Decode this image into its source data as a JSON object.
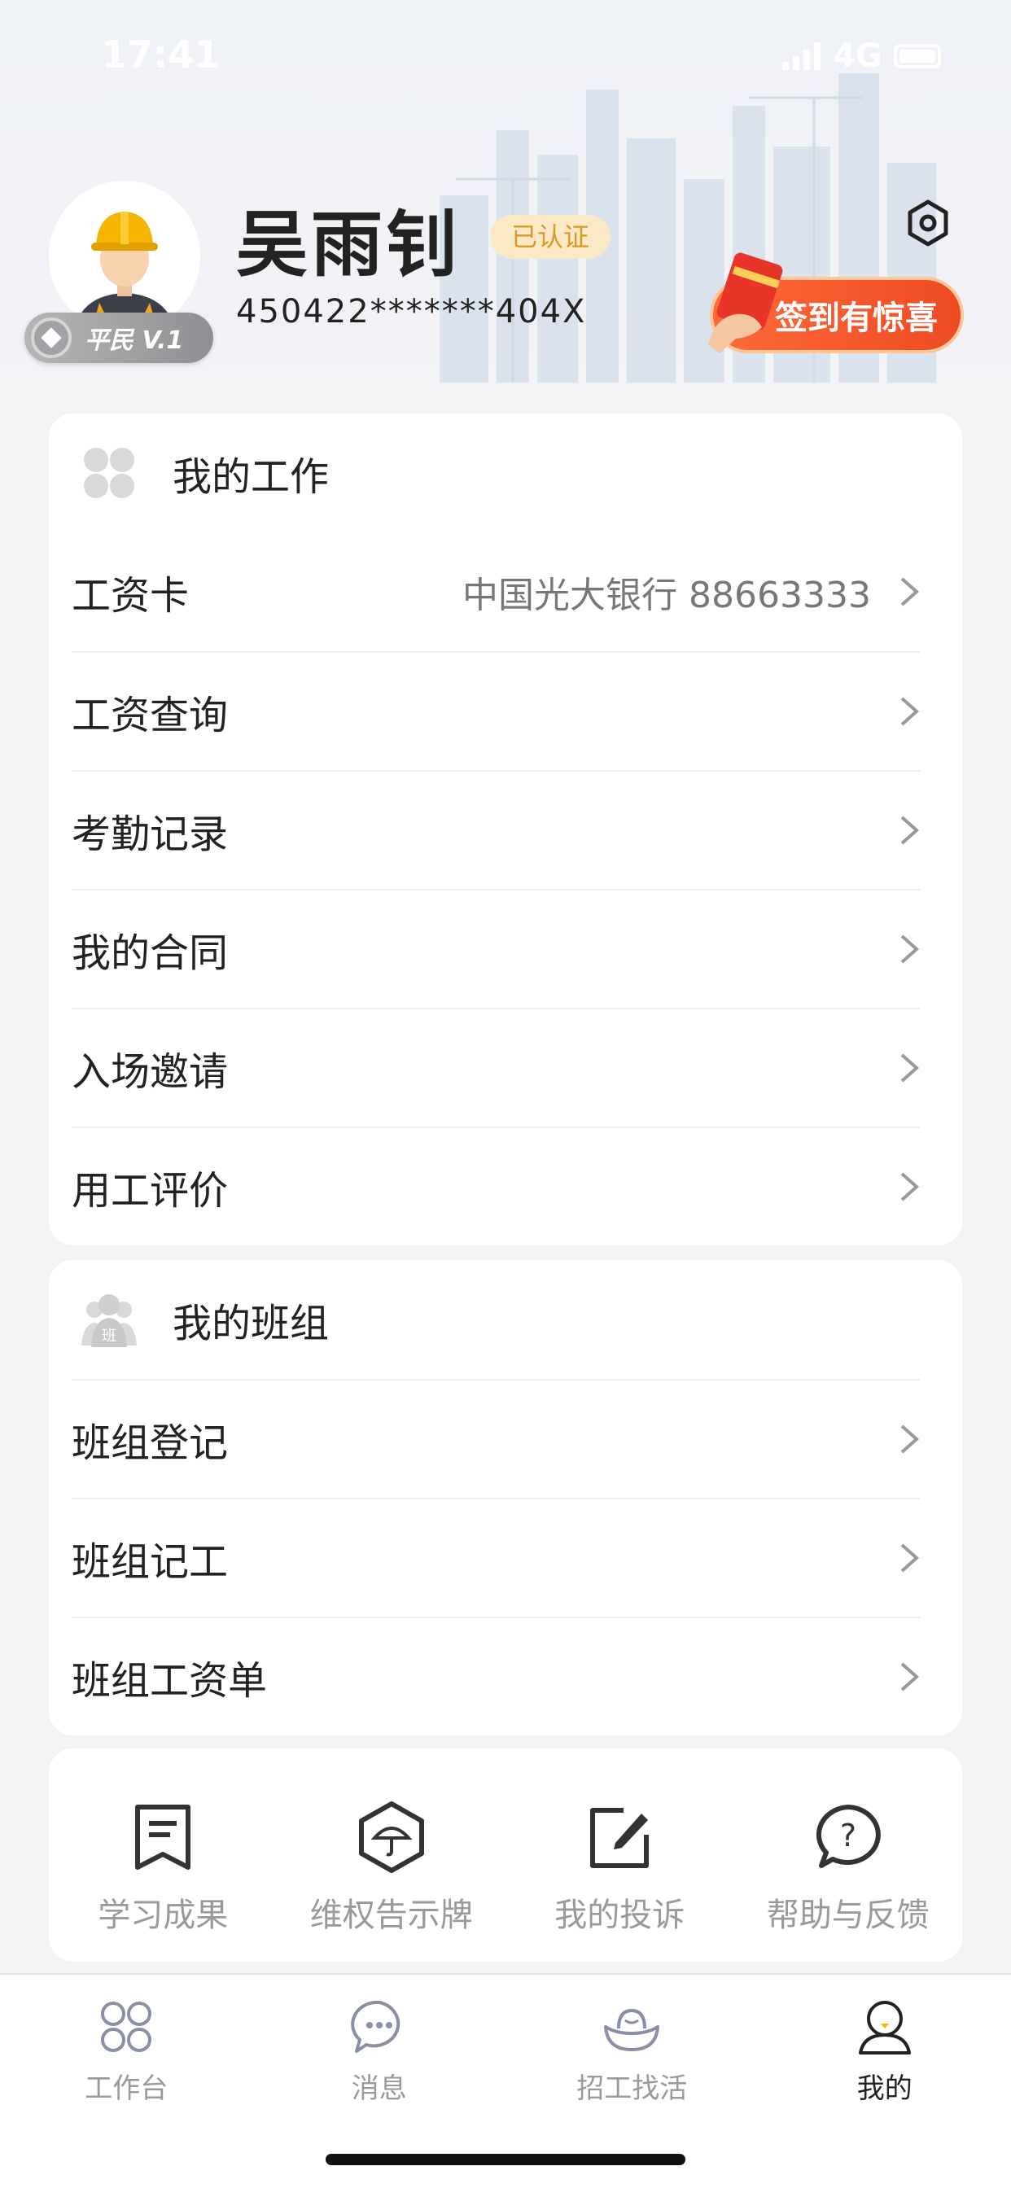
{
  "status_bar": {
    "time": "17:41",
    "network": "4G"
  },
  "profile": {
    "name": "吴雨钊",
    "verified_label": "已认证",
    "id_number": "450422*******404X",
    "level_badge": "平民 V.1",
    "checkin_label": "签到有惊喜"
  },
  "my_work": {
    "title": "我的工作",
    "items": [
      {
        "label": "工资卡",
        "value": "中国光大银行 88663333"
      },
      {
        "label": "工资查询",
        "value": ""
      },
      {
        "label": "考勤记录",
        "value": ""
      },
      {
        "label": "我的合同",
        "value": ""
      },
      {
        "label": "入场邀请",
        "value": ""
      },
      {
        "label": "用工评价",
        "value": ""
      }
    ]
  },
  "my_team": {
    "title": "我的班组",
    "items": [
      {
        "label": "班组登记"
      },
      {
        "label": "班组记工"
      },
      {
        "label": "班组工资单"
      }
    ]
  },
  "shortcuts": [
    {
      "label": "学习成果",
      "icon": "bookmark-icon"
    },
    {
      "label": "维权告示牌",
      "icon": "umbrella-hexagon-icon"
    },
    {
      "label": "我的投诉",
      "icon": "edit-icon"
    },
    {
      "label": "帮助与反馈",
      "icon": "question-bubble-icon"
    }
  ],
  "tabbar": [
    {
      "label": "工作台",
      "icon": "grid-icon",
      "active": false
    },
    {
      "label": "消息",
      "icon": "chat-icon",
      "active": false
    },
    {
      "label": "招工找活",
      "icon": "ingot-icon",
      "active": false
    },
    {
      "label": "我的",
      "icon": "person-icon",
      "active": true
    }
  ],
  "colors": {
    "accent_orange": "#ee4a22",
    "verified_bg": "#fbe9c6",
    "verified_text": "#d49a2a",
    "page_bg": "#f3f3f6"
  }
}
